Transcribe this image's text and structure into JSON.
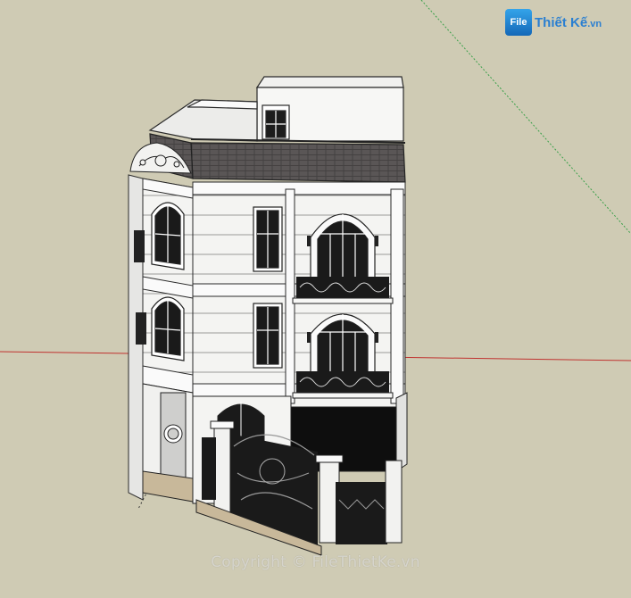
{
  "viewport": {
    "background": "#cfcbb4",
    "model": "building-model",
    "axis_colors": {
      "red": "#c0322f",
      "green": "#3aa04a"
    }
  },
  "watermark": {
    "badge_text": "File",
    "brand_text": "Thiết Kế",
    "brand_suffix": ".vn",
    "copyright": "Copyright © FileThietKe.vn"
  }
}
